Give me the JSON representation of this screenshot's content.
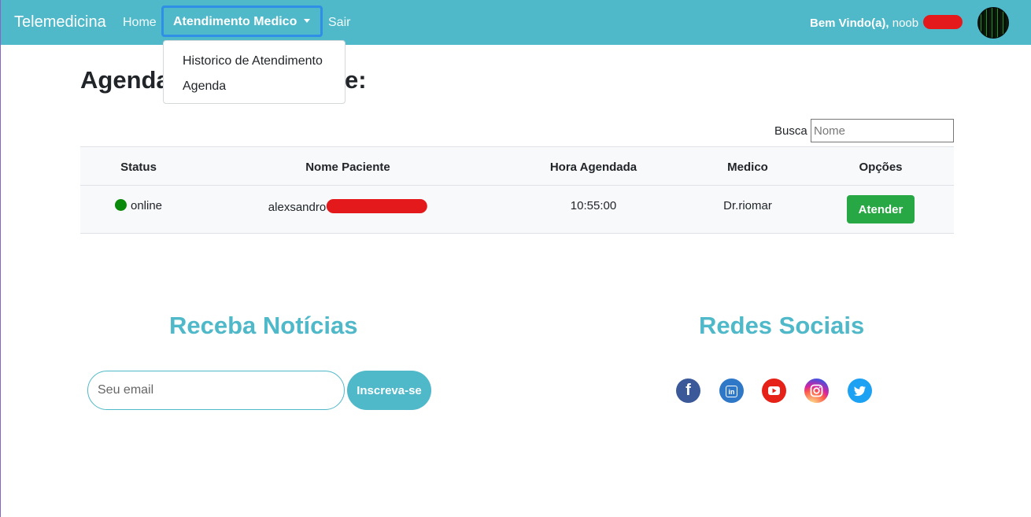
{
  "navbar": {
    "brand": "Telemedicina",
    "home": "Home",
    "dropdown_label": "Atendimento Medico",
    "logout": "Sair",
    "welcome_bold": "Bem Vindo(a),",
    "username": "noob",
    "colors": {
      "background": "#4fb8c9",
      "focus_border": "#2f8ee6"
    }
  },
  "dropdown": {
    "items": [
      {
        "label": "Historico de Atendimento"
      },
      {
        "label": "Agenda"
      }
    ]
  },
  "page": {
    "title": "Agenda",
    "title_tail": "e:"
  },
  "search": {
    "label": "Busca",
    "placeholder": "Nome",
    "value": ""
  },
  "table": {
    "headers": [
      "Status",
      "Nome Paciente",
      "Hora Agendada",
      "Medico",
      "Opções"
    ],
    "rows": [
      {
        "status": "online",
        "status_color": "#0a8a0a",
        "patient": "alexsandro",
        "time": "10:55:00",
        "doctor": "Dr.riomar",
        "action": "Atender"
      }
    ]
  },
  "footer": {
    "news_title": "Receba Notícias",
    "email_placeholder": "Seu email",
    "subscribe_label": "Inscreva-se",
    "social_title": "Redes Sociais",
    "social_icons": [
      "facebook-icon",
      "linkedin-icon",
      "youtube-icon",
      "instagram-icon",
      "twitter-icon"
    ],
    "accent_color": "#4fb8c9"
  }
}
